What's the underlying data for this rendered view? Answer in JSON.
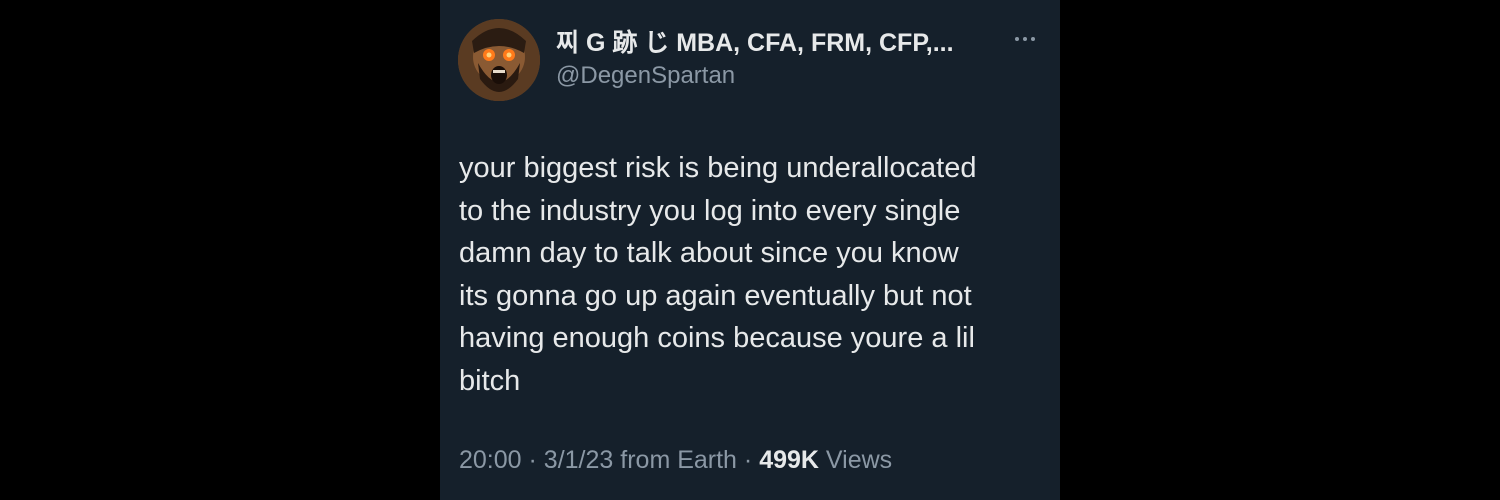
{
  "author": {
    "display_name": "찌 G 跡 じ MBA, CFA, FRM, CFP,...",
    "handle": "@DegenSpartan",
    "avatar_icon": "spartan-avatar-icon"
  },
  "tweet": {
    "text": "your biggest risk is being underallocated\nto the industry you log into every single\ndamn day to talk about since you know\nits gonna go up again eventually but not\nhaving enough coins because youre a lil\nbitch"
  },
  "meta": {
    "time": "20:00",
    "separator": "·",
    "date": "3/1/23",
    "source": "from Earth",
    "views_count": "499K",
    "views_label": "Views"
  },
  "menu": {
    "icon": "more-options-icon"
  },
  "colors": {
    "background": "#000000",
    "card": "#15202b",
    "primary_text": "#e7e9ea",
    "secondary_text": "#8b98a5"
  }
}
